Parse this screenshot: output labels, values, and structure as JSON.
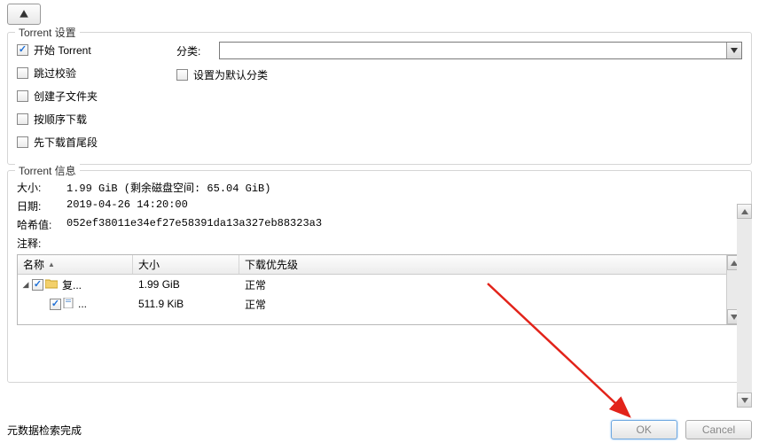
{
  "settings": {
    "title": "Torrent 设置",
    "start_torrent": {
      "label": "开始 Torrent",
      "checked": true
    },
    "skip_check": {
      "label": "跳过校验",
      "checked": false
    },
    "create_subfolder": {
      "label": "创建子文件夹",
      "checked": false
    },
    "sequential": {
      "label": "按顺序下载",
      "checked": false
    },
    "first_last": {
      "label": "先下载首尾段",
      "checked": false
    },
    "category_label": "分类:",
    "category_value": "",
    "set_default_category": {
      "label": "设置为默认分类",
      "checked": false
    }
  },
  "info": {
    "title": "Torrent 信息",
    "size_label": "大小:",
    "size_value": "1.99 GiB (剩余磁盘空间: 65.04 GiB)",
    "date_label": "日期:",
    "date_value": "2019-04-26 14:20:00",
    "hash_label": "哈希值:",
    "hash_value": "052ef38011e34ef27e58391da13a327eb88323a3",
    "comment_label": "注释:",
    "comment_value": ""
  },
  "table": {
    "headers": {
      "name": "名称",
      "size": "大小",
      "priority": "下载优先级"
    },
    "rows": [
      {
        "indent": 0,
        "expanded": true,
        "checked": true,
        "icon": "folder",
        "name": "复...",
        "size": "1.99 GiB",
        "priority": "正常"
      },
      {
        "indent": 1,
        "expanded": false,
        "checked": true,
        "icon": "file",
        "name": "...",
        "size": "511.9 KiB",
        "priority": "正常"
      }
    ]
  },
  "footer": {
    "status": "元数据检索完成",
    "ok": "OK",
    "cancel": "Cancel"
  }
}
